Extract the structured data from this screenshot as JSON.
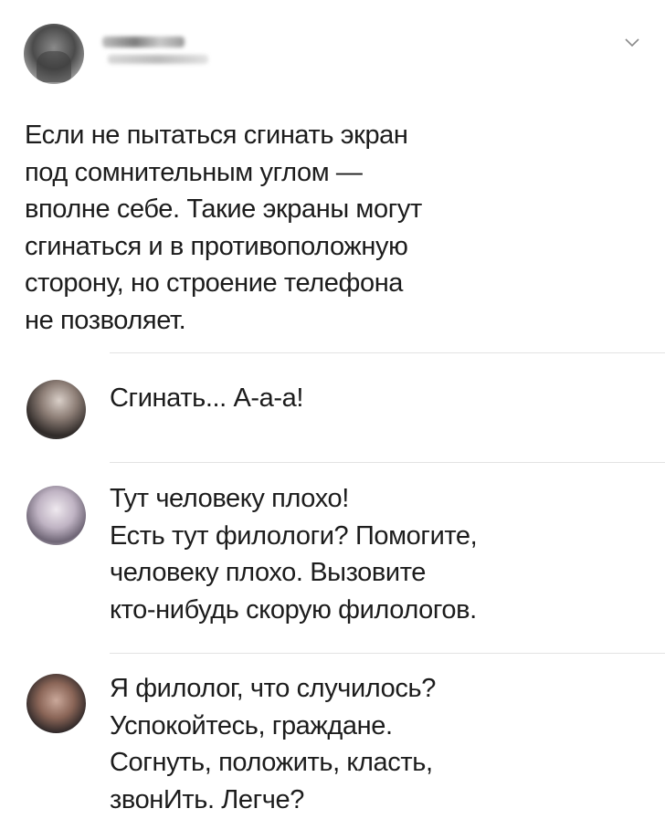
{
  "post": {
    "author_name": "",
    "author_handle": "",
    "text": "Если не пытаться сгинать экран\nпод сомнительным углом —\nвполне себе. Такие экраны могут\nсгинаться и в противоположную\nсторону, но строение телефона\nне позволяет."
  },
  "icons": {
    "menu": "chevron-down-icon"
  },
  "replies": [
    {
      "text": "Сгинать... А-а-а!"
    },
    {
      "text": "Тут человеку плохо!\nЕсть тут филологи? Помогите,\nчеловеку плохо. Вызовите\nкто-нибудь скорую филологов."
    },
    {
      "text": "Я филолог, что случилось?\nУспокойтесь, граждане.\nСогнуть, положить, класть,\nзвонИть. Легче?"
    }
  ]
}
